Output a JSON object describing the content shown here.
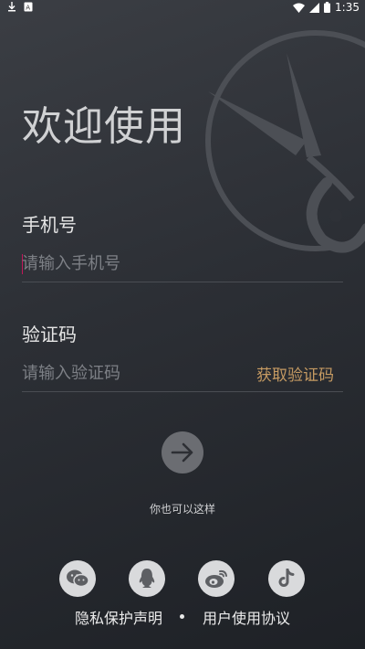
{
  "status_bar": {
    "time": "1:35"
  },
  "title": "欢迎使用",
  "phone": {
    "label": "手机号",
    "placeholder": "请输入手机号"
  },
  "code": {
    "label": "验证码",
    "placeholder": "请输入验证码",
    "get_code": "获取验证码"
  },
  "alt_login_text": "你也可以这样",
  "social_icons": [
    "wechat-icon",
    "qq-icon",
    "weibo-icon",
    "tiktok-icon"
  ],
  "footer": {
    "privacy": "隐私保护声明",
    "terms": "用户使用协议"
  },
  "colors": {
    "accent": "#c59a62",
    "cursor": "#c2185b",
    "background": "#2c2f35"
  }
}
